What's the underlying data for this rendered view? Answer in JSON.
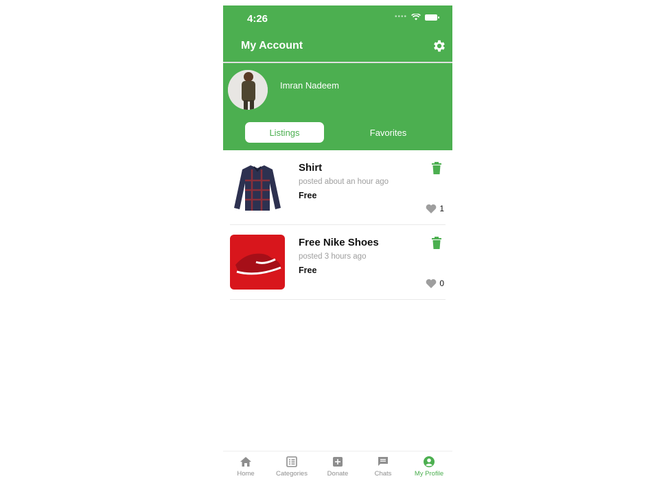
{
  "status": {
    "time": "4:26"
  },
  "header": {
    "title": "My Account",
    "settings_icon": "gear-icon"
  },
  "profile": {
    "name": "Imran Nadeem"
  },
  "tabs": [
    {
      "label": "Listings",
      "active": true
    },
    {
      "label": "Favorites",
      "active": false
    }
  ],
  "listings": [
    {
      "title": "Shirt",
      "posted": "posted about an hour ago",
      "price": "Free",
      "likes": "1"
    },
    {
      "title": "Free Nike Shoes",
      "posted": "posted 3 hours ago",
      "price": "Free",
      "likes": "0"
    }
  ],
  "tabbar": [
    {
      "label": "Home",
      "icon": "home-icon"
    },
    {
      "label": "Categories",
      "icon": "list-icon"
    },
    {
      "label": "Donate",
      "icon": "plus-box-icon"
    },
    {
      "label": "Chats",
      "icon": "chat-icon"
    },
    {
      "label": "My Profile",
      "icon": "profile-icon",
      "active": true
    }
  ],
  "colors": {
    "accent": "#4caf50",
    "muted": "#8e8e8e"
  }
}
